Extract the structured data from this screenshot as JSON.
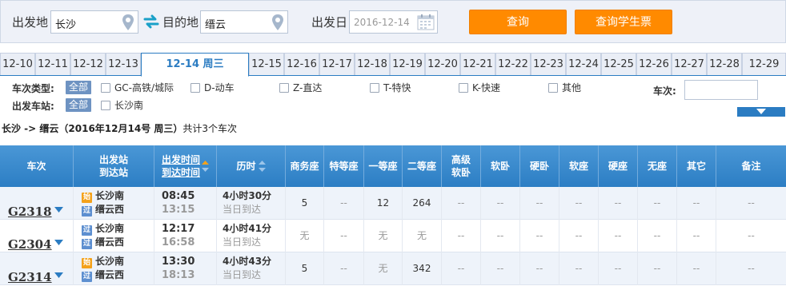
{
  "search": {
    "from_label": "出发地",
    "from_value": "长沙",
    "to_label": "目的地",
    "to_value": "缙云",
    "date_label": "出发日",
    "date_placeholder": "2016-12-14",
    "query_button": "查询",
    "student_button": "查询学生票"
  },
  "date_tabs": [
    "12-10",
    "12-11",
    "12-12",
    "12-13",
    "12-14 周三",
    "12-15",
    "12-16",
    "12-17",
    "12-18",
    "12-19",
    "12-20",
    "12-21",
    "12-22",
    "12-23",
    "12-24",
    "12-25",
    "12-26",
    "12-27",
    "12-28",
    "12-29"
  ],
  "active_date": "12-14 周三",
  "filters": {
    "type_label": "车次类型:",
    "station_label": "出发车站:",
    "all_label": "全部",
    "types": [
      "GC-高铁/城际",
      "D-动车",
      "Z-直达",
      "T-特快",
      "K-快速",
      "其他"
    ],
    "stations": [
      "长沙南"
    ],
    "train_no_label": "车次:"
  },
  "summary": {
    "route": "长沙 -> 缙云（2016年12月14号  周三）",
    "count": "共计3个车次"
  },
  "table": {
    "headers": {
      "train": "车次",
      "station_dep": "出发站",
      "station_arr": "到达站",
      "time_dep": "出发时间",
      "time_arr": "到达时间",
      "duration": "历时",
      "business": "商务座",
      "special": "特等座",
      "first": "一等座",
      "second": "二等座",
      "senior_soft_1": "高级",
      "senior_soft_2": "软卧",
      "soft_sleeper": "软卧",
      "hard_sleeper": "硬卧",
      "soft_seat": "软座",
      "hard_seat": "硬座",
      "standing": "无座",
      "other": "其它",
      "remark": "备注"
    },
    "tags": {
      "start": "始",
      "pass": "过"
    },
    "rows": [
      {
        "train_no": "G2318",
        "from": "长沙南",
        "to": "缙云西",
        "from_tag": "始",
        "to_tag": "过",
        "dep": "08:45",
        "arr": "13:15",
        "duration": "4小时30分",
        "arrive_day": "当日到达",
        "seats": [
          "5",
          "--",
          "12",
          "264",
          "--",
          "--",
          "--",
          "--",
          "--",
          "--",
          "--",
          "--"
        ]
      },
      {
        "train_no": "G2304",
        "from": "长沙南",
        "to": "缙云西",
        "from_tag": "过",
        "to_tag": "过",
        "dep": "12:17",
        "arr": "16:58",
        "duration": "4小时41分",
        "arrive_day": "当日到达",
        "seats": [
          "无",
          "--",
          "无",
          "无",
          "--",
          "--",
          "--",
          "--",
          "--",
          "--",
          "--",
          "--"
        ]
      },
      {
        "train_no": "G2314",
        "from": "长沙南",
        "to": "缙云西",
        "from_tag": "始",
        "to_tag": "过",
        "dep": "13:30",
        "arr": "18:13",
        "duration": "4小时43分",
        "arrive_day": "当日到达",
        "seats": [
          "5",
          "--",
          "无",
          "342",
          "--",
          "--",
          "--",
          "--",
          "--",
          "--",
          "--",
          "--"
        ]
      }
    ]
  },
  "colors": {
    "accent": "#2b7cc2",
    "button": "#ff8a00",
    "start_tag": "#f4a21b",
    "pass_tag": "#5d8fd0"
  },
  "icons": {
    "location": "map-pin-icon",
    "swap": "swap-arrows-icon",
    "calendar": "calendar-icon",
    "expand": "triangle-down-icon"
  }
}
